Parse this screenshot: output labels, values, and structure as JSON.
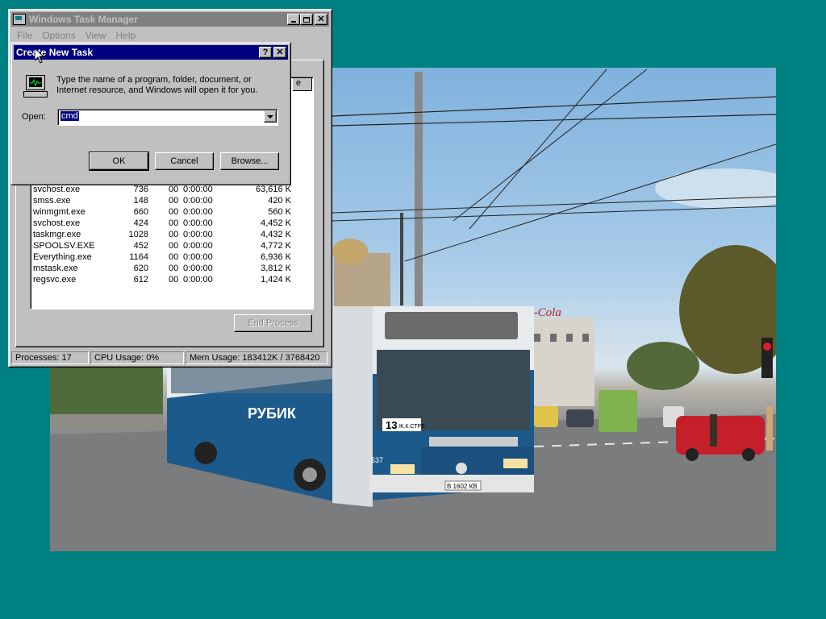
{
  "task_manager": {
    "title": "Windows Task Manager",
    "menus": [
      "File",
      "Options",
      "View",
      "Help"
    ],
    "processes": [
      {
        "name": "svchost.exe",
        "pid": "736",
        "cpu": "00",
        "time": "0:00:00",
        "mem": "63,616 K"
      },
      {
        "name": "smss.exe",
        "pid": "148",
        "cpu": "00",
        "time": "0:00:00",
        "mem": "420 K"
      },
      {
        "name": "winmgmt.exe",
        "pid": "660",
        "cpu": "00",
        "time": "0:00:00",
        "mem": "560 K"
      },
      {
        "name": "svchost.exe",
        "pid": "424",
        "cpu": "00",
        "time": "0:00:00",
        "mem": "4,452 K"
      },
      {
        "name": "taskmgr.exe",
        "pid": "1028",
        "cpu": "00",
        "time": "0:00:00",
        "mem": "4,432 K"
      },
      {
        "name": "SPOOLSV.EXE",
        "pid": "452",
        "cpu": "00",
        "time": "0:00:00",
        "mem": "4,772 K"
      },
      {
        "name": "Everything.exe",
        "pid": "1164",
        "cpu": "00",
        "time": "0:00:00",
        "mem": "6,936 K"
      },
      {
        "name": "mstask.exe",
        "pid": "620",
        "cpu": "00",
        "time": "0:00:00",
        "mem": "3,812 K"
      },
      {
        "name": "regsvc.exe",
        "pid": "612",
        "cpu": "00",
        "time": "0:00:00",
        "mem": "1,424 K"
      }
    ],
    "partial_column_header": "e",
    "end_process_label": "End Process",
    "status": {
      "processes": "Processes: 17",
      "cpu": "CPU Usage: 0%",
      "mem": "Mem Usage: 183412K / 3768420"
    }
  },
  "dialog": {
    "title": "Create New Task",
    "help_glyph": "?",
    "close_glyph": "✕",
    "description": "Type the name of a program, folder, document, or Internet resource, and Windows will open it for you.",
    "open_label": "Open:",
    "open_value": "cmd",
    "ok_label": "OK",
    "cancel_label": "Cancel",
    "browse_label": "Browse..."
  },
  "wallpaper": {
    "bus_route": "13",
    "bus_sign_text": "Ж.К.СТРЕ",
    "bus_ad_text": "РУБИК",
    "bus_number": "537",
    "plate": "В 1602 КВ",
    "building_sign": "Coca-Cola"
  },
  "colors": {
    "desktop": "#008080",
    "active_title": "#000080",
    "inactive_title": "#808080",
    "bus_blue": "#1d5a8c"
  }
}
